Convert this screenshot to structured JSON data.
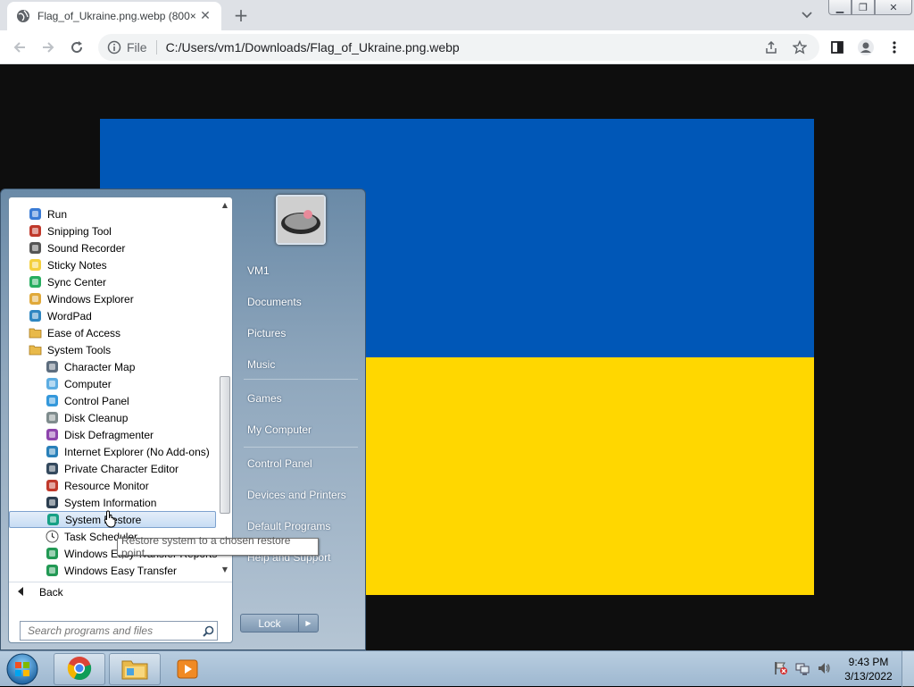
{
  "browser": {
    "tab_title": "Flag_of_Ukraine.png.webp (800×",
    "url_scheme": "File",
    "url": "C:/Users/vm1/Downloads/Flag_of_Ukraine.png.webp"
  },
  "flag": {
    "top_color": "#0057b7",
    "bottom_color": "#ffd700"
  },
  "start_menu": {
    "programs": [
      {
        "label": "Run",
        "icon": "run-icon",
        "indent": 0
      },
      {
        "label": "Snipping Tool",
        "icon": "scissors-icon",
        "indent": 0
      },
      {
        "label": "Sound Recorder",
        "icon": "microphone-icon",
        "indent": 0
      },
      {
        "label": "Sticky Notes",
        "icon": "sticky-note-icon",
        "indent": 0
      },
      {
        "label": "Sync Center",
        "icon": "sync-icon",
        "indent": 0
      },
      {
        "label": "Windows Explorer",
        "icon": "folder-explorer-icon",
        "indent": 0
      },
      {
        "label": "WordPad",
        "icon": "wordpad-icon",
        "indent": 0
      },
      {
        "label": "Ease of Access",
        "icon": "folder-icon",
        "indent": 0
      },
      {
        "label": "System Tools",
        "icon": "folder-icon",
        "indent": 0
      },
      {
        "label": "Character Map",
        "icon": "character-map-icon",
        "indent": 1
      },
      {
        "label": "Computer",
        "icon": "computer-icon",
        "indent": 1
      },
      {
        "label": "Control Panel",
        "icon": "control-panel-icon",
        "indent": 1
      },
      {
        "label": "Disk Cleanup",
        "icon": "disk-cleanup-icon",
        "indent": 1
      },
      {
        "label": "Disk Defragmenter",
        "icon": "defrag-icon",
        "indent": 1
      },
      {
        "label": "Internet Explorer (No Add-ons)",
        "icon": "ie-icon",
        "indent": 1
      },
      {
        "label": "Private Character Editor",
        "icon": "char-editor-icon",
        "indent": 1
      },
      {
        "label": "Resource Monitor",
        "icon": "resource-monitor-icon",
        "indent": 1
      },
      {
        "label": "System Information",
        "icon": "system-info-icon",
        "indent": 1
      },
      {
        "label": "System Restore",
        "icon": "system-restore-icon",
        "indent": 1,
        "selected": true
      },
      {
        "label": "Task Scheduler",
        "icon": "clock-icon",
        "indent": 1
      },
      {
        "label": "Windows Easy Transfer Reports",
        "icon": "easy-transfer-icon",
        "indent": 1
      },
      {
        "label": "Windows Easy Transfer",
        "icon": "easy-transfer-icon",
        "indent": 1
      }
    ],
    "back_label": "Back",
    "search_placeholder": "Search programs and files",
    "right_links": [
      "VM1",
      "Documents",
      "Pictures",
      "Music",
      "Games",
      "My Computer",
      "Control Panel",
      "Devices and Printers",
      "Default Programs",
      "Help and Support"
    ],
    "lock_label": "Lock",
    "tooltip": "Restore system to a chosen restore point."
  },
  "taskbar": {
    "time": "9:43 PM",
    "date": "3/13/2022",
    "apps": [
      "chrome-icon",
      "file-explorer-icon",
      "media-player-icon"
    ]
  }
}
